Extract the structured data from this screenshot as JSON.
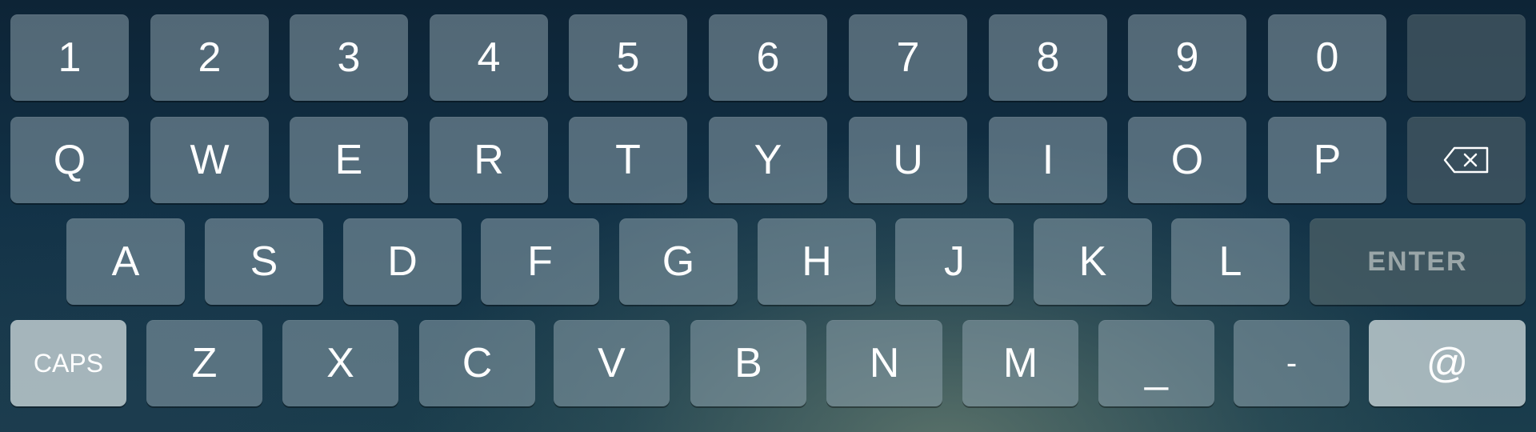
{
  "keyboard": {
    "row1": [
      "1",
      "2",
      "3",
      "4",
      "5",
      "6",
      "7",
      "8",
      "9",
      "0",
      ""
    ],
    "row2": [
      "Q",
      "W",
      "E",
      "R",
      "T",
      "Y",
      "U",
      "I",
      "O",
      "P"
    ],
    "row2_backspace_icon": "backspace-icon",
    "row3": [
      "A",
      "S",
      "D",
      "F",
      "G",
      "H",
      "J",
      "K",
      "L"
    ],
    "row3_enter": "ENTER",
    "row4_caps": "CAPS",
    "row4": [
      "Z",
      "X",
      "C",
      "V",
      "B",
      "N",
      "M",
      "_",
      "-"
    ],
    "row4_at": "@"
  },
  "colors": {
    "key_fill": "#8ca0ac",
    "key_dark_fill": "#465a64",
    "key_light_fill": "#c8d4d7",
    "key_text": "#ffffff",
    "enter_text": "#9aa6a8"
  }
}
